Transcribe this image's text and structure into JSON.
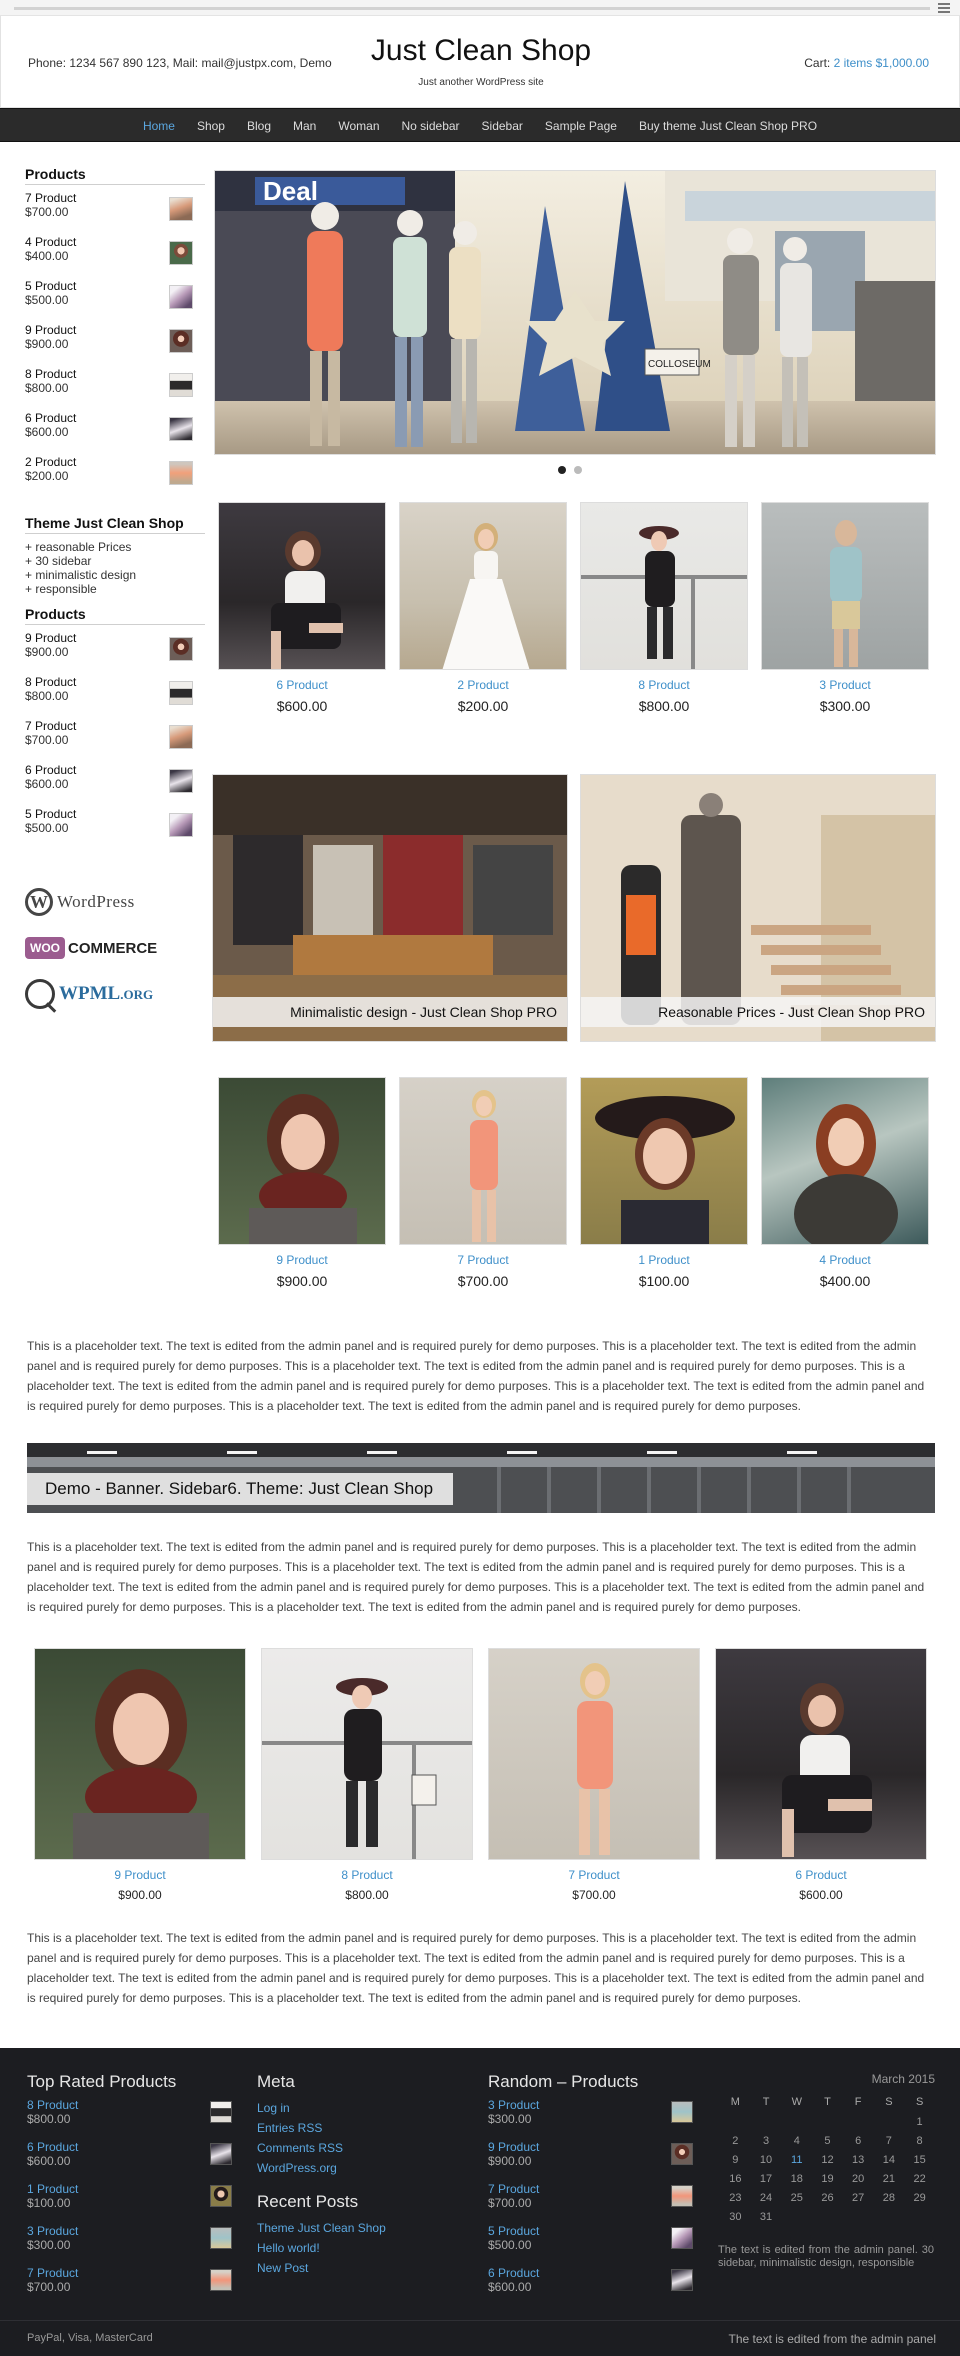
{
  "header": {
    "contact": "Phone: 1234 567 890 123, Mail: mail@justpx.com, Demo",
    "title": "Just Clean Shop",
    "tagline": "Just another WordPress site",
    "cart_label": "Cart:",
    "cart_value": "2 items $1,000.00"
  },
  "nav": [
    "Home",
    "Shop",
    "Blog",
    "Man",
    "Woman",
    "No sidebar",
    "Sidebar",
    "Sample Page",
    "Buy theme Just Clean Shop PRO"
  ],
  "sidebar": {
    "products_title": "Products",
    "products": [
      {
        "name": "7 Product",
        "price": "$700.00"
      },
      {
        "name": "4 Product",
        "price": "$400.00"
      },
      {
        "name": "5 Product",
        "price": "$500.00"
      },
      {
        "name": "9 Product",
        "price": "$900.00"
      },
      {
        "name": "8 Product",
        "price": "$800.00"
      },
      {
        "name": "6 Product",
        "price": "$600.00"
      },
      {
        "name": "2 Product",
        "price": "$200.00"
      }
    ],
    "theme_title": "Theme Just Clean Shop",
    "features": [
      "+ reasonable Prices",
      "+ 30 sidebar",
      "+ minimalistic design",
      "+ responsible"
    ],
    "products2_title": "Products",
    "products2": [
      {
        "name": "9 Product",
        "price": "$900.00"
      },
      {
        "name": "8 Product",
        "price": "$800.00"
      },
      {
        "name": "7 Product",
        "price": "$700.00"
      },
      {
        "name": "6 Product",
        "price": "$600.00"
      },
      {
        "name": "5 Product",
        "price": "$500.00"
      }
    ],
    "logos": {
      "wordpress": "WordPress",
      "woo": "WOO",
      "commerce": "COMMERCE",
      "wpml": "WPML",
      "wpml_org": ".ORG"
    }
  },
  "slider": {
    "sign_main": "Deal",
    "sign_store": "COLLOSEUM"
  },
  "grid1": [
    {
      "name": "6 Product",
      "price": "$600.00"
    },
    {
      "name": "2 Product",
      "price": "$200.00"
    },
    {
      "name": "8 Product",
      "price": "$800.00"
    },
    {
      "name": "3 Product",
      "price": "$300.00"
    }
  ],
  "banners": [
    {
      "caption": "Minimalistic design - Just Clean Shop PRO"
    },
    {
      "caption": "Reasonable Prices - Just Clean Shop PRO"
    }
  ],
  "grid2": [
    {
      "name": "9 Product",
      "price": "$900.00"
    },
    {
      "name": "7 Product",
      "price": "$700.00"
    },
    {
      "name": "1 Product",
      "price": "$100.00"
    },
    {
      "name": "4 Product",
      "price": "$400.00"
    }
  ],
  "placeholder_text": "This is a placeholder text. The text is edited from the admin panel and is required purely for demo purposes. This is a placeholder text. The text is edited from the admin panel and is required purely for demo purposes. This is a placeholder text. The text is edited from the admin panel and is required purely for demo purposes. This is a placeholder text. The text is edited from the admin panel and is required purely for demo purposes. This is a placeholder text. The text is edited from the admin panel and is required purely for demo purposes. This is a placeholder text. The text is edited from the admin panel and is required purely for demo purposes.",
  "wide_banner": "Demo - Banner. Sidebar6. Theme: Just Clean Shop",
  "grid3": [
    {
      "name": "9 Product",
      "price": "$900.00"
    },
    {
      "name": "8 Product",
      "price": "$800.00"
    },
    {
      "name": "7 Product",
      "price": "$700.00"
    },
    {
      "name": "6 Product",
      "price": "$600.00"
    }
  ],
  "footer": {
    "top_rated_title": "Top Rated Products",
    "top_rated": [
      {
        "name": "8 Product",
        "price": "$800.00"
      },
      {
        "name": "6 Product",
        "price": "$600.00"
      },
      {
        "name": "1 Product",
        "price": "$100.00"
      },
      {
        "name": "3 Product",
        "price": "$300.00"
      },
      {
        "name": "7 Product",
        "price": "$700.00"
      }
    ],
    "meta_title": "Meta",
    "meta_links": [
      "Log in",
      "Entries RSS",
      "Comments RSS",
      "WordPress.org"
    ],
    "recent_title": "Recent Posts",
    "recent_links": [
      "Theme Just Clean Shop",
      "Hello world!",
      "New Post"
    ],
    "random_title": "Random – Products",
    "random": [
      {
        "name": "3 Product",
        "price": "$300.00"
      },
      {
        "name": "9 Product",
        "price": "$900.00"
      },
      {
        "name": "7 Product",
        "price": "$700.00"
      },
      {
        "name": "5 Product",
        "price": "$500.00"
      },
      {
        "name": "6 Product",
        "price": "$600.00"
      }
    ],
    "calendar_caption": "March 2015",
    "calendar_days": [
      "M",
      "T",
      "W",
      "T",
      "F",
      "S",
      "S"
    ],
    "calendar_rows": [
      [
        "",
        "",
        "",
        "",
        "",
        "",
        "1"
      ],
      [
        "2",
        "3",
        "4",
        "5",
        "6",
        "7",
        "8"
      ],
      [
        "9",
        "10",
        "11",
        "12",
        "13",
        "14",
        "15"
      ],
      [
        "16",
        "17",
        "18",
        "19",
        "20",
        "21",
        "22"
      ],
      [
        "23",
        "24",
        "25",
        "26",
        "27",
        "28",
        "29"
      ],
      [
        "30",
        "31",
        "",
        "",
        "",
        "",
        ""
      ]
    ],
    "calendar_link_day": "11",
    "note": "The text is edited from the admin panel. 30 sidebar, minimalistic design, responsible",
    "bottom_left": "PayPal, Visa, MasterCard",
    "bottom_right": "The text is edited from the admin panel"
  },
  "colors": {
    "accent": "#3e8fc9",
    "nav_bg": "#2b2b2b",
    "footer_bg": "#1c1d21",
    "nav_active": "#5ba7df"
  }
}
